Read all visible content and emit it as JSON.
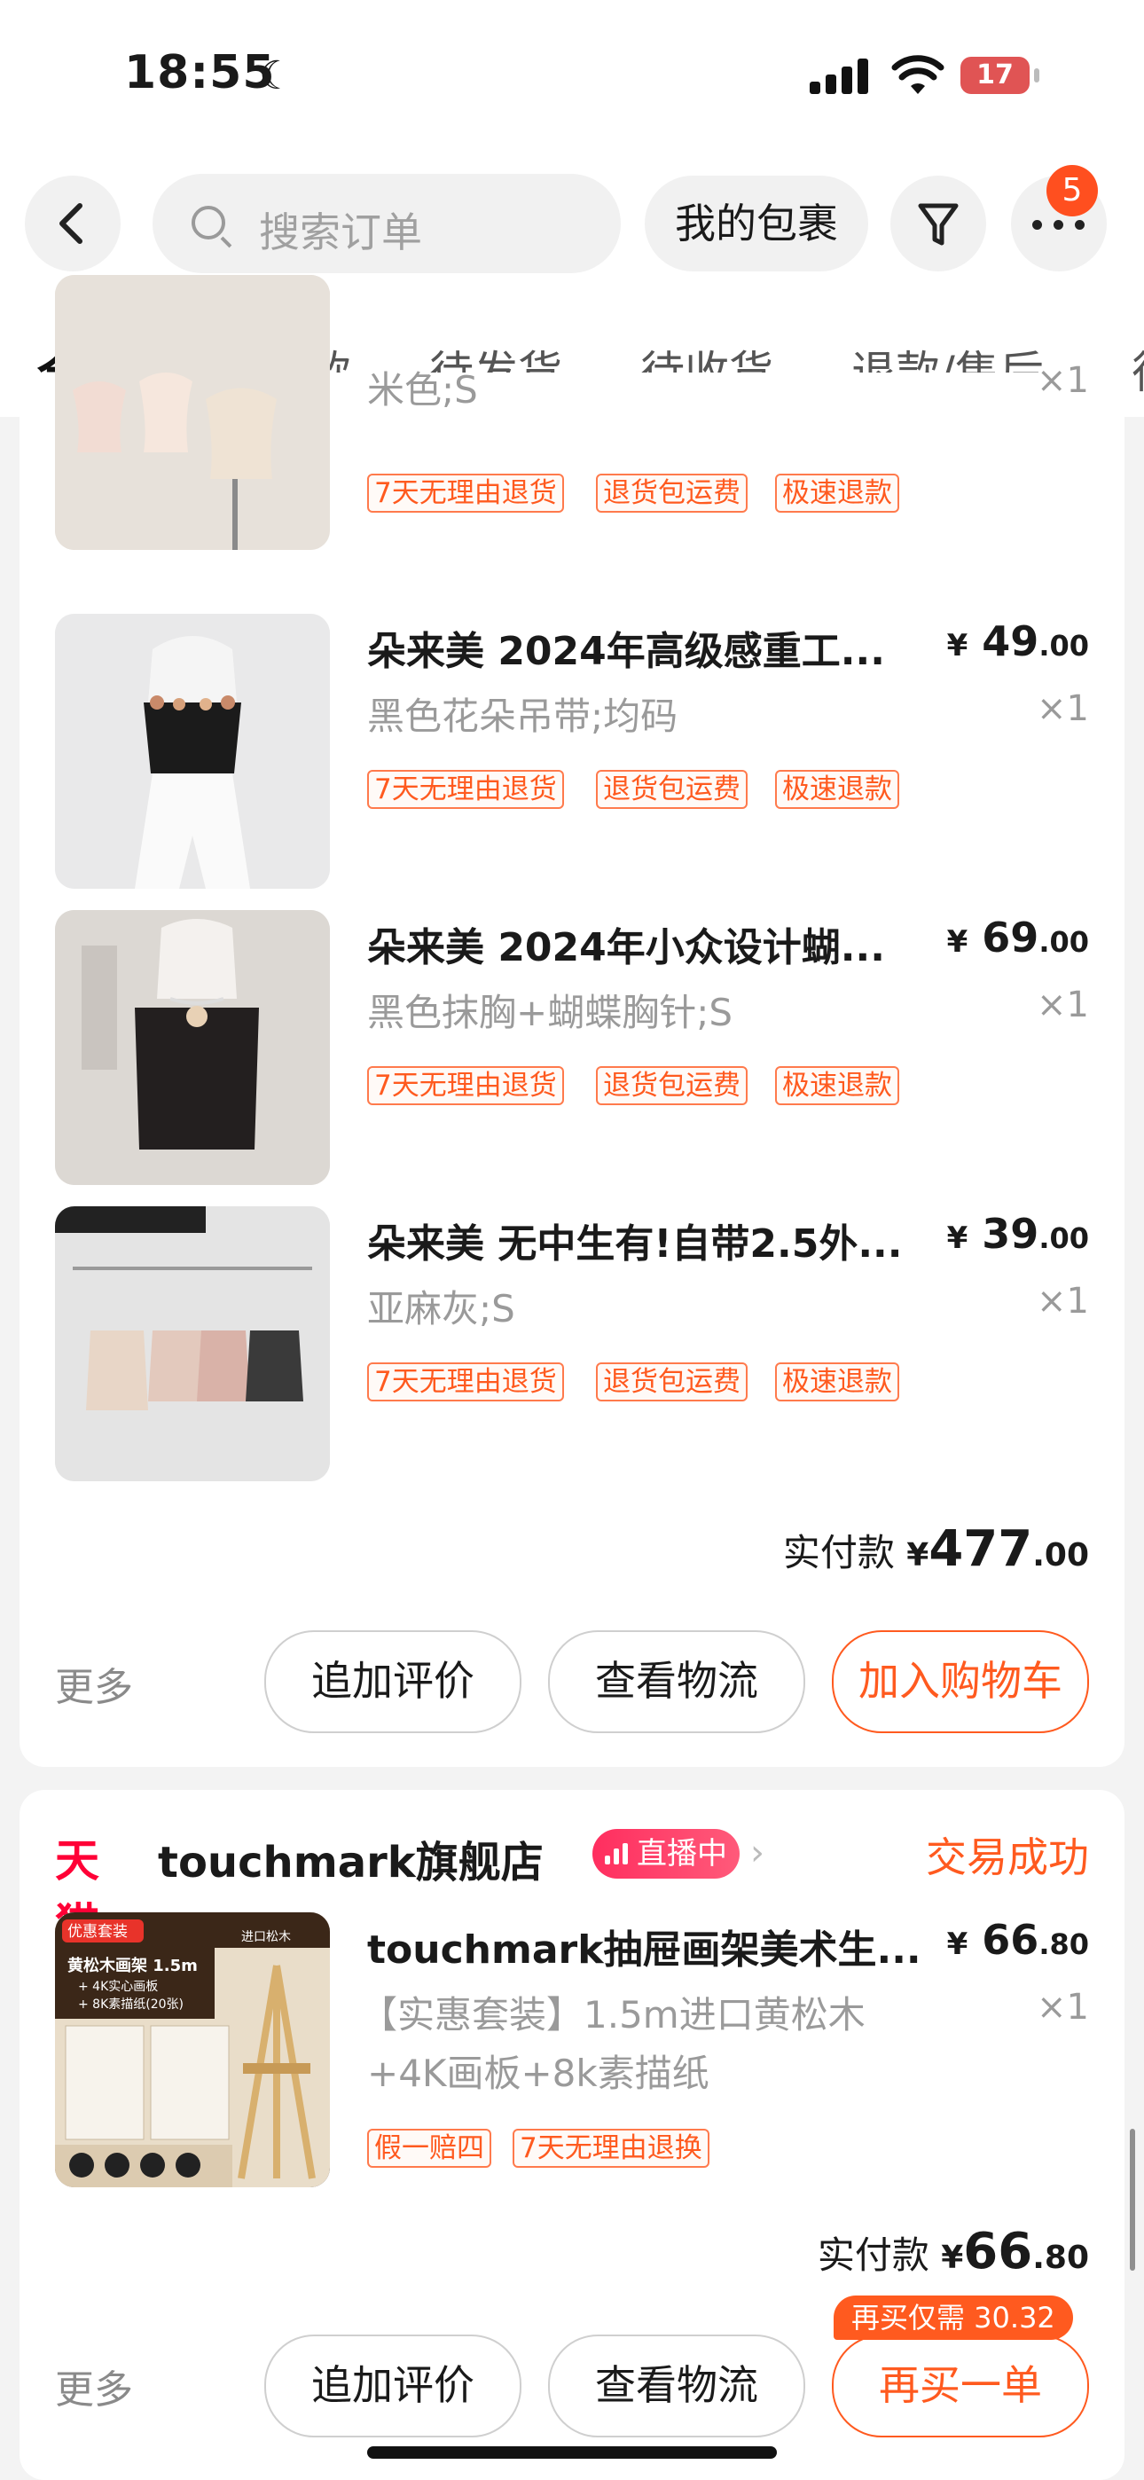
{
  "status_bar": {
    "time": "18:55",
    "battery": "17"
  },
  "header": {
    "search_placeholder": "搜索订单",
    "packages_label": "我的包裹",
    "more_badge": "5"
  },
  "tabs": [
    "全部",
    "待付款",
    "待发货",
    "待收货",
    "退款/售后",
    "待"
  ],
  "order1": {
    "items": [
      {
        "title": "",
        "sku": "米色;S",
        "price_int": "",
        "price_dec": "",
        "qty": "×1",
        "tags": [
          "7天无理由退货",
          "退货包运费",
          "极速退款"
        ]
      },
      {
        "title": "朵来美 2024年高级感重工...",
        "sku": "黑色花朵吊带;均码",
        "price_int": "49",
        "price_dec": ".00",
        "qty": "×1",
        "tags": [
          "7天无理由退货",
          "退货包运费",
          "极速退款"
        ]
      },
      {
        "title": "朵来美 2024年小众设计蝴...",
        "sku": "黑色抹胸+蝴蝶胸针;S",
        "price_int": "69",
        "price_dec": ".00",
        "qty": "×1",
        "tags": [
          "7天无理由退货",
          "退货包运费",
          "极速退款"
        ]
      },
      {
        "title": "朵来美 无中生有!自带2.5外...",
        "sku": "亚麻灰;S",
        "price_int": "39",
        "price_dec": ".00",
        "qty": "×1",
        "tags": [
          "7天无理由退货",
          "退货包运费",
          "极速退款"
        ]
      }
    ],
    "total_label": "实付款",
    "currency": "¥",
    "total_int": "477",
    "total_dec": ".00",
    "more": "更多",
    "buttons": {
      "review": "追加评价",
      "logistics": "查看物流",
      "add_cart": "加入购物车"
    }
  },
  "order2": {
    "platform": "天猫",
    "store": "touchmark旗舰店",
    "live": "直播中",
    "status": "交易成功",
    "item": {
      "title": "touchmark抽屉画架美术生...",
      "sku_line1": "【实惠套装】1.5m进口黄松木",
      "sku_line2": "+4K画板+8k素描纸",
      "price_int": "66",
      "price_dec": ".80",
      "qty": "×1",
      "tags": [
        "假一赔四",
        "7天无理由退换"
      ],
      "thumb_text": {
        "banner": "优惠套装",
        "line1": "黄松木画架 1.5m",
        "line2": "+ 4K实心画板",
        "line3": "+ 8K素描纸(20张)",
        "logo": "进口松木"
      }
    },
    "total_label": "实付款",
    "currency": "¥",
    "total_int": "66",
    "total_dec": ".80",
    "more": "更多",
    "buttons": {
      "review": "追加评价",
      "logistics": "查看物流",
      "rebuy": "再买一单"
    },
    "rebuy_badge": "再买仅需 30.32"
  }
}
